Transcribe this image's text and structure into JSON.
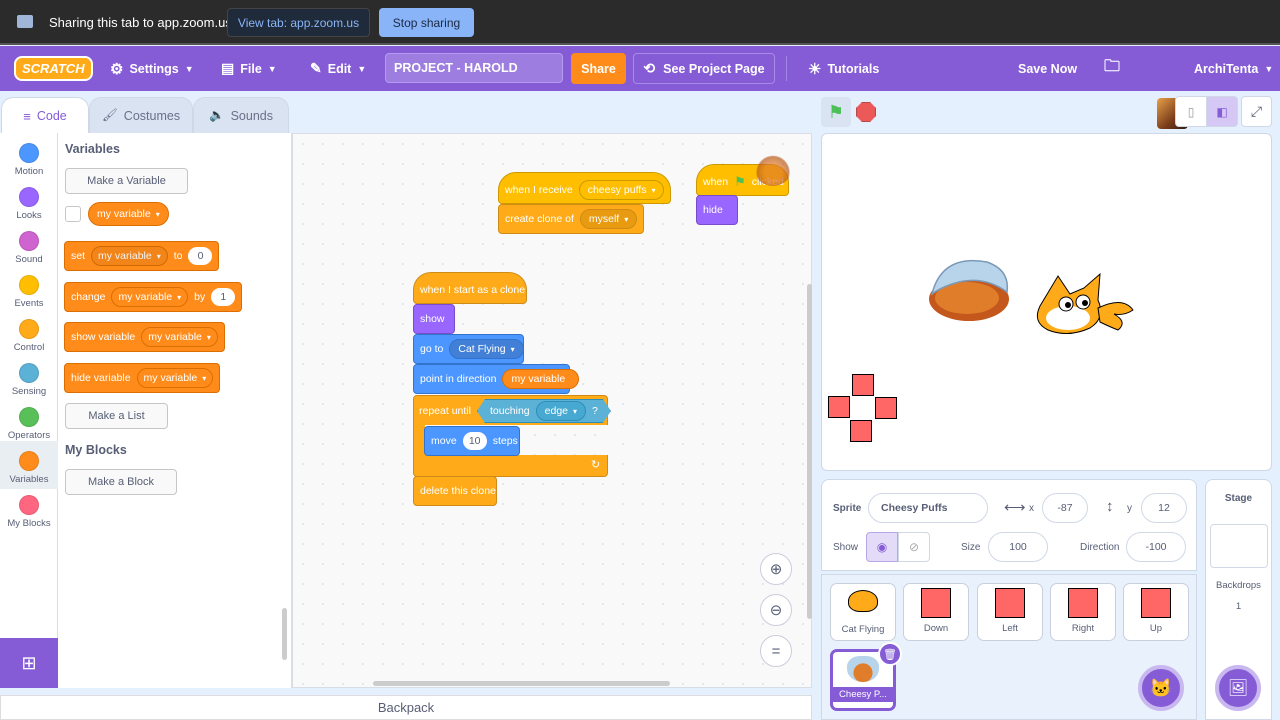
{
  "zoom": {
    "sharing_text": "Sharing this tab to app.zoom.us",
    "view_tab": "View tab: app.zoom.us",
    "stop_sharing": "Stop sharing"
  },
  "menu": {
    "logo": "SCRATCH",
    "settings": "Settings",
    "file": "File",
    "edit": "Edit",
    "project_title": "PROJECT - HAROLD",
    "share": "Share",
    "see_project": "See Project Page",
    "tutorials": "Tutorials",
    "save_now": "Save Now",
    "username": "ArchiTenta"
  },
  "tabs": {
    "code": "Code",
    "costumes": "Costumes",
    "sounds": "Sounds"
  },
  "categories": [
    {
      "label": "Motion",
      "color": "#4c97ff"
    },
    {
      "label": "Looks",
      "color": "#9966ff"
    },
    {
      "label": "Sound",
      "color": "#cf63cf"
    },
    {
      "label": "Events",
      "color": "#ffbf00"
    },
    {
      "label": "Control",
      "color": "#ffab19"
    },
    {
      "label": "Sensing",
      "color": "#5cb1d6"
    },
    {
      "label": "Operators",
      "color": "#59c059"
    },
    {
      "label": "Variables",
      "color": "#ff8c1a"
    },
    {
      "label": "My Blocks",
      "color": "#ff6680"
    }
  ],
  "palette": {
    "variables_title": "Variables",
    "make_variable": "Make a Variable",
    "var_name": "my variable",
    "set": "set",
    "to": "to",
    "set_value": "0",
    "change": "change",
    "by": "by",
    "change_value": "1",
    "show_variable": "show variable",
    "hide_variable": "hide variable",
    "make_list": "Make a List",
    "myblocks_title": "My Blocks",
    "make_block": "Make a Block"
  },
  "script1": {
    "when_receive": "when I receive",
    "message": "cheesy puffs",
    "create_clone": "create clone of",
    "clone_target": "myself"
  },
  "script2": {
    "when": "when",
    "clicked": "clicked",
    "hide": "hide"
  },
  "script3": {
    "hat": "when I start as a clone",
    "show": "show",
    "go_to": "go to",
    "go_target": "Cat Flying",
    "point": "point in direction",
    "point_var": "my variable",
    "repeat_until": "repeat until",
    "touching": "touching",
    "touch_target": "edge",
    "q": "?",
    "move": "move",
    "steps_val": "10",
    "steps": "steps",
    "delete_clone": "delete this clone"
  },
  "sprite_info": {
    "sprite_label": "Sprite",
    "sprite_name": "Cheesy Puffs",
    "x_label": "x",
    "x_val": "-87",
    "y_label": "y",
    "y_val": "12",
    "show_label": "Show",
    "size_label": "Size",
    "size_val": "100",
    "dir_label": "Direction",
    "dir_val": "-100"
  },
  "sprites": [
    {
      "name": "Cat Flying"
    },
    {
      "name": "Down"
    },
    {
      "name": "Left"
    },
    {
      "name": "Right"
    },
    {
      "name": "Up"
    },
    {
      "name": "Cheesy P..."
    }
  ],
  "stage_panel": {
    "title": "Stage",
    "backdrops_label": "Backdrops",
    "backdrops_count": "1"
  },
  "backpack": "Backpack"
}
